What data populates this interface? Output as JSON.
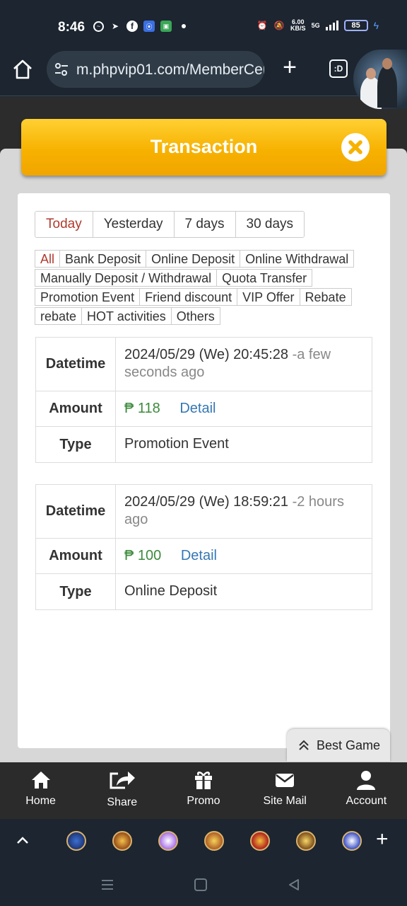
{
  "status": {
    "time": "8:46",
    "speed_value": "6.00",
    "speed_unit": "KB/S",
    "network": "5G",
    "battery": "85"
  },
  "browser": {
    "url": "m.phpvip01.com/MemberCer",
    "tabs_label": ":D"
  },
  "page": {
    "title": "Transaction"
  },
  "date_filters": [
    {
      "label": "Today",
      "active": true
    },
    {
      "label": "Yesterday",
      "active": false
    },
    {
      "label": "7 days",
      "active": false
    },
    {
      "label": "30 days",
      "active": false
    }
  ],
  "type_filters": [
    [
      "All",
      "Bank Deposit",
      "Online Deposit",
      "Online Withdrawal"
    ],
    [
      "Manually Deposit / Withdrawal",
      "Quota Transfer"
    ],
    [
      "Promotion Event",
      "Friend discount",
      "VIP Offer",
      "Rebate"
    ],
    [
      "rebate",
      "HOT activities",
      "Others"
    ]
  ],
  "labels": {
    "datetime": "Datetime",
    "amount": "Amount",
    "type": "Type",
    "detail": "Detail"
  },
  "transactions": [
    {
      "datetime": "2024/05/29 (We) 20:45:28",
      "ago": "-a few seconds ago",
      "amount": "₱ 118",
      "type": "Promotion Event"
    },
    {
      "datetime": "2024/05/29 (We) 18:59:21",
      "ago": "-2 hours ago",
      "amount": "₱ 100",
      "type": "Online Deposit"
    }
  ],
  "best_game": "Best Game",
  "bottom_nav": [
    "Home",
    "Share",
    "Promo",
    "Site Mail",
    "Account"
  ],
  "colors": {
    "accent": "#f7b200",
    "active_filter": "#b03a2e",
    "money": "#3c8a3c",
    "link": "#3577b5"
  }
}
